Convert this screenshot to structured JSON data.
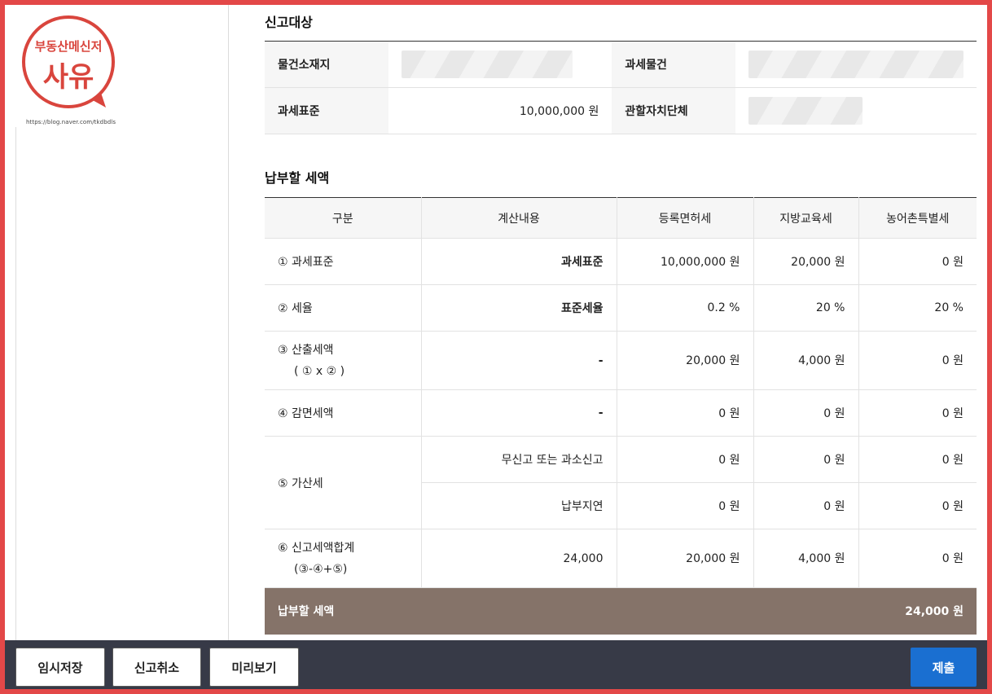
{
  "logo": {
    "line1": "부동산메신저",
    "line2": "사유",
    "url": "https://blog.naver.com/tkdbdls"
  },
  "target": {
    "title": "신고대상",
    "rows": [
      {
        "label1": "물건소재지",
        "value1": "",
        "label2": "과세물건",
        "value2": ""
      },
      {
        "label1": "과세표준",
        "value1": "10,000,000 원",
        "label2": "관할자치단체",
        "value2": ""
      }
    ]
  },
  "tax": {
    "title": "납부할 세액",
    "headers": [
      "구분",
      "계산내용",
      "등록면허세",
      "지방교육세",
      "농어촌특별세"
    ],
    "row1": {
      "label": "① 과세표준",
      "calc": "과세표준",
      "reg": "10,000,000 원",
      "edu": "20,000 원",
      "rural": "0 원"
    },
    "row2": {
      "label": "② 세율",
      "calc": "표준세율",
      "reg": "0.2 %",
      "edu": "20 %",
      "rural": "20 %"
    },
    "row3": {
      "label": "③ 산출세액",
      "sub": "( ① x ② )",
      "calc": "-",
      "reg": "20,000 원",
      "edu": "4,000 원",
      "rural": "0 원"
    },
    "row4": {
      "label": "④ 감면세액",
      "calc": "-",
      "reg": "0 원",
      "edu": "0 원",
      "rural": "0 원"
    },
    "row5": {
      "label": "⑤ 가산세",
      "a": {
        "calc": "무신고 또는 과소신고",
        "reg": "0 원",
        "edu": "0 원",
        "rural": "0 원"
      },
      "b": {
        "calc": "납부지연",
        "reg": "0 원",
        "edu": "0 원",
        "rural": "0 원"
      }
    },
    "row6": {
      "label": "⑥ 신고세액합계",
      "sub": "(③-④+⑤)",
      "calc": "24,000",
      "reg": "20,000 원",
      "edu": "4,000 원",
      "rural": "0 원"
    },
    "total": {
      "label": "납부할 세액",
      "value": "24,000 원"
    }
  },
  "buttons": {
    "save": "임시저장",
    "cancel": "신고취소",
    "preview": "미리보기",
    "submit": "제출"
  },
  "colors": {
    "frame": "#e34848",
    "total_row": "#857369",
    "bottom_bar": "#373a47",
    "submit": "#1a6fd1",
    "logo": "#d9453d"
  }
}
